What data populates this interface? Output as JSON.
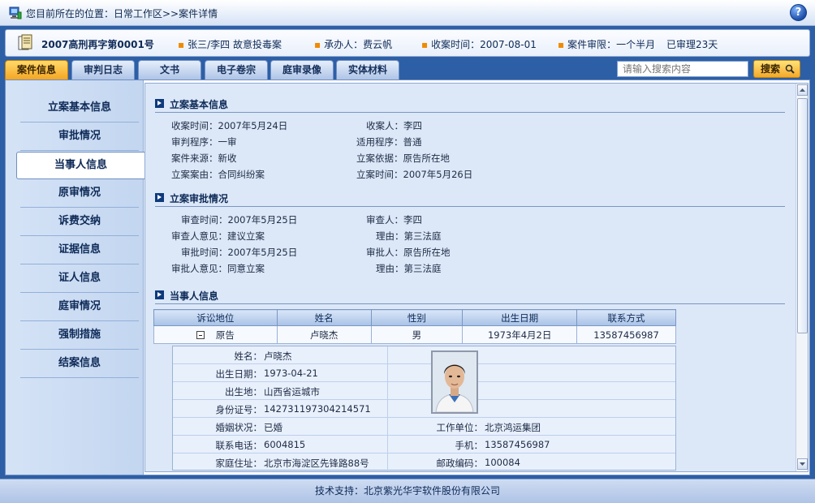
{
  "location": {
    "text": "您目前所在的位置：日常工作区>>案件详情"
  },
  "help": {
    "label": "?"
  },
  "case_bar": {
    "case_no": "2007高刑再字第0001号",
    "parties": "张三/李四 故意投毒案",
    "handler": "承办人：费云帆",
    "received": "收案时间：2007-08-01",
    "deadline": "案件审限：一个半月",
    "elapsed": "已审理23天"
  },
  "tabs": [
    {
      "label": "案件信息"
    },
    {
      "label": "审判日志"
    },
    {
      "label": "文书"
    },
    {
      "label": "电子卷宗"
    },
    {
      "label": "庭审录像"
    },
    {
      "label": "实体材料"
    }
  ],
  "search": {
    "placeholder": "请输入搜索内容",
    "button_label": "搜索"
  },
  "sidenav": [
    {
      "label": "立案基本信息"
    },
    {
      "label": "审批情况"
    },
    {
      "label": "当事人信息"
    },
    {
      "label": "原审情况"
    },
    {
      "label": "诉费交纳"
    },
    {
      "label": "证据信息"
    },
    {
      "label": "证人信息"
    },
    {
      "label": "庭审情况"
    },
    {
      "label": "强制措施"
    },
    {
      "label": "结案信息"
    }
  ],
  "basic": {
    "title": "立案基本信息",
    "received_time": "收案时间：2007年5月24日",
    "receiver": "收案人：李四",
    "trial_procedure": "审判程序：一审",
    "applicable_procedure": "适用程序：普通",
    "case_source": "案件来源：新收",
    "filing_basis": "立案依据：原告所在地",
    "filing_cause": "立案案由：合同纠纷案",
    "filing_time": "立案时间：2007年5月26日"
  },
  "approval": {
    "title": "立案审批情况",
    "review_time": "审查时间：2007年5月25日",
    "reviewer": "审查人：李四",
    "reviewer_opinion": "审查人意见：建议立案",
    "reason1": "理由：第三法庭",
    "approve_time": "审批时间：2007年5月25日",
    "approver": "审批人：原告所在地",
    "approver_opinion": "审批人意见：同意立案",
    "reason2": "理由：第三法庭"
  },
  "parties": {
    "title": "当事人信息",
    "headers": [
      "诉讼地位",
      "姓名",
      "性别",
      "出生日期",
      "联系方式"
    ],
    "row": [
      "原告",
      "卢晓杰",
      "男",
      "1973年4月2日",
      "13587456987"
    ],
    "detail": {
      "name_label": "姓名：",
      "name": "卢晓杰",
      "dob_label": "出生日期：",
      "dob": "1973-04-21",
      "birthplace_label": "出生地：",
      "birthplace": "山西省运城市",
      "id_label": "身份证号：",
      "id": "142731197304214571",
      "marital_label": "婚姻状况：",
      "marital": "已婚",
      "employer_label": "工作单位：",
      "employer": "北京鸿运集团",
      "phone_label": "联系电话：",
      "phone": "6004815",
      "mobile_label": "手机：",
      "mobile": "13587456987",
      "address_label": "家庭住址：",
      "address": "北京市海淀区先锋路88号",
      "postcode_label": "邮政编码：",
      "postcode": "100084"
    }
  },
  "footer": {
    "text": "技术支持：北京紫光华宇软件股份有限公司"
  }
}
